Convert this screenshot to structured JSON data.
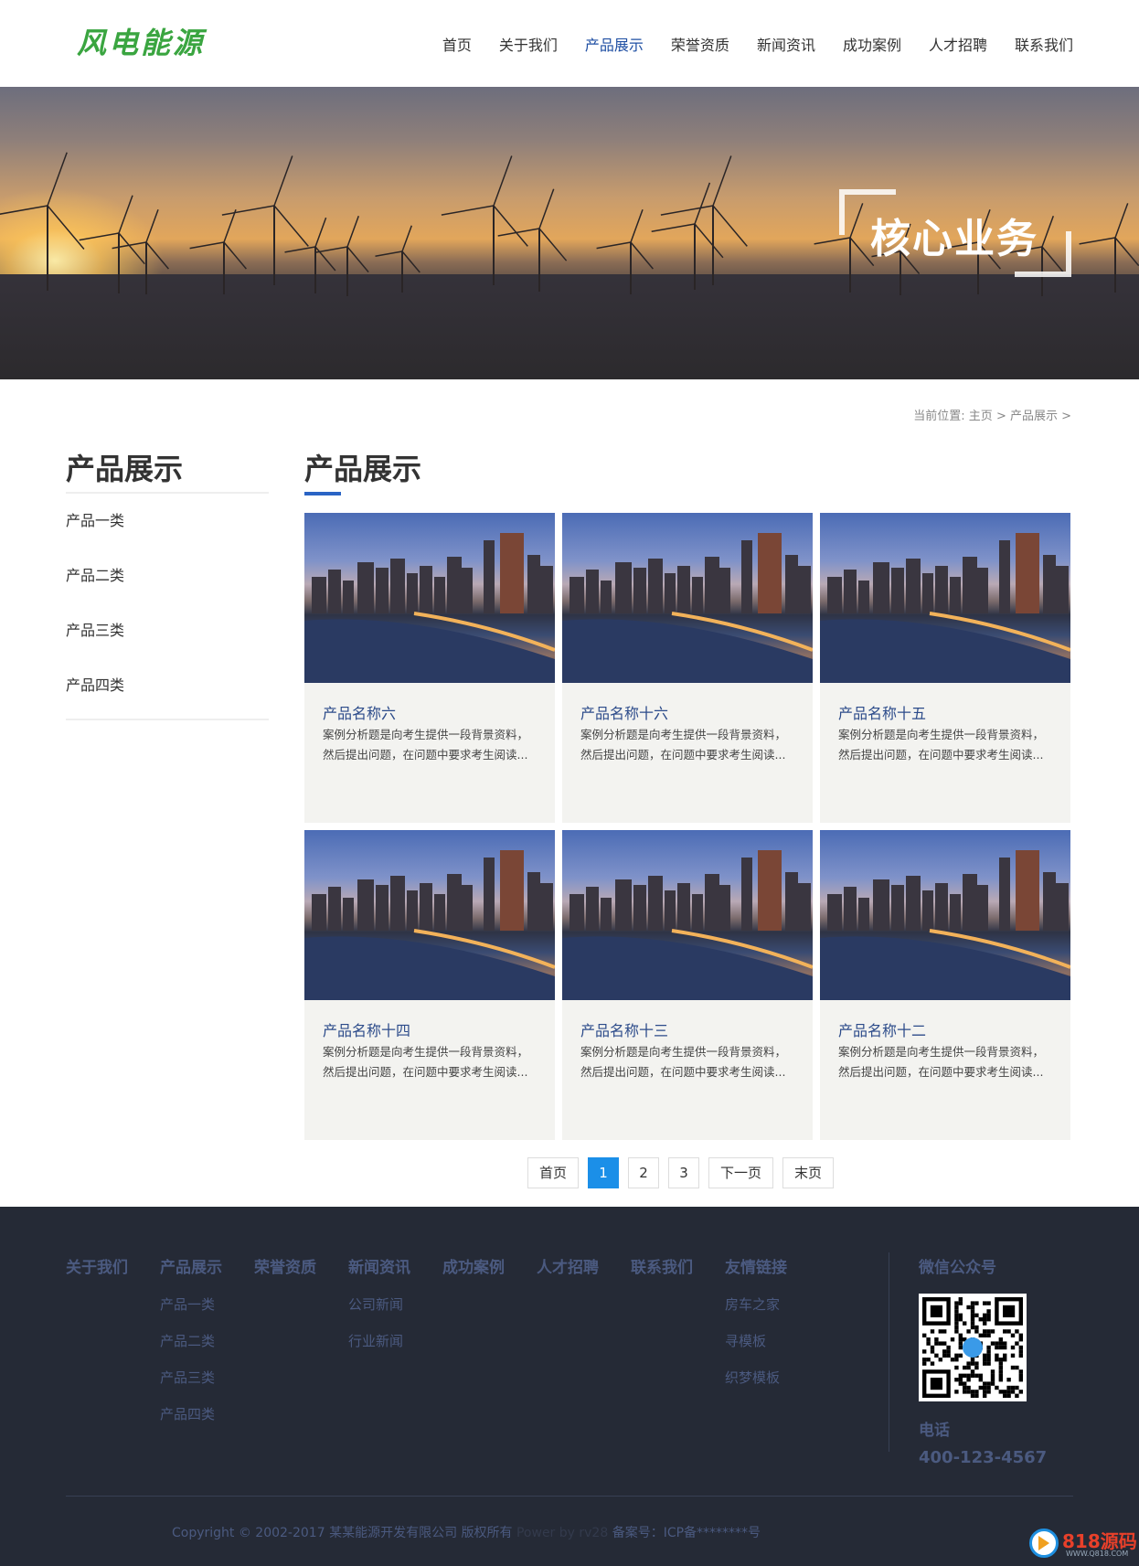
{
  "header": {
    "logo": "风电能源",
    "nav": [
      {
        "label": "首页",
        "active": false
      },
      {
        "label": "关于我们",
        "active": false
      },
      {
        "label": "产品展示",
        "active": true
      },
      {
        "label": "荣誉资质",
        "active": false
      },
      {
        "label": "新闻资讯",
        "active": false
      },
      {
        "label": "成功案例",
        "active": false
      },
      {
        "label": "人才招聘",
        "active": false
      },
      {
        "label": "联系我们",
        "active": false
      }
    ]
  },
  "banner": {
    "title": "核心业务"
  },
  "breadcrumb": "当前位置: 主页 > 产品展示 >",
  "sidebar": {
    "title": "产品展示",
    "items": [
      {
        "label": "产品一类"
      },
      {
        "label": "产品二类"
      },
      {
        "label": "产品三类"
      },
      {
        "label": "产品四类"
      }
    ]
  },
  "main": {
    "title": "产品展示",
    "products": [
      {
        "name": "产品名称六",
        "desc1": "案例分析题是向考生提供一段背景资料，",
        "desc2": "然后提出问题，在问题中要求考生阅读..."
      },
      {
        "name": "产品名称十六",
        "desc1": "案例分析题是向考生提供一段背景资料，",
        "desc2": "然后提出问题，在问题中要求考生阅读..."
      },
      {
        "name": "产品名称十五",
        "desc1": "案例分析题是向考生提供一段背景资料，",
        "desc2": "然后提出问题，在问题中要求考生阅读..."
      },
      {
        "name": "产品名称十四",
        "desc1": "案例分析题是向考生提供一段背景资料，",
        "desc2": "然后提出问题，在问题中要求考生阅读..."
      },
      {
        "name": "产品名称十三",
        "desc1": "案例分析题是向考生提供一段背景资料，",
        "desc2": "然后提出问题，在问题中要求考生阅读..."
      },
      {
        "name": "产品名称十二",
        "desc1": "案例分析题是向考生提供一段背景资料，",
        "desc2": "然后提出问题，在问题中要求考生阅读..."
      }
    ]
  },
  "pagination": {
    "first": "首页",
    "pages": [
      "1",
      "2",
      "3"
    ],
    "current": "1",
    "next": "下一页",
    "last": "末页"
  },
  "footer": {
    "columns": [
      {
        "head": "关于我们",
        "links": []
      },
      {
        "head": "产品展示",
        "links": [
          "产品一类",
          "产品二类",
          "产品三类",
          "产品四类"
        ]
      },
      {
        "head": "荣誉资质",
        "links": []
      },
      {
        "head": "新闻资讯",
        "links": [
          "公司新闻",
          "行业新闻"
        ]
      },
      {
        "head": "成功案例",
        "links": []
      },
      {
        "head": "人才招聘",
        "links": []
      },
      {
        "head": "联系我们",
        "links": []
      },
      {
        "head": "友情链接",
        "links": [
          "房车之家",
          "寻模板",
          "织梦模板"
        ]
      }
    ],
    "wechat_title": "微信公众号",
    "tel_label": "电话",
    "tel": "400-123-4567",
    "copyright": "Copyright © 2002-2017 某某能源开发有限公司 版权所有",
    "powered": "Power by rv28",
    "icp": "备案号：ICP备********号"
  },
  "watermark": {
    "text": "818源码",
    "sub": "WWW.Q818.COM"
  },
  "colors": {
    "accent": "#1f4fa3",
    "logo": "#3aa540",
    "pager_active": "#1b8fe8",
    "footer_bg": "#252a36"
  }
}
